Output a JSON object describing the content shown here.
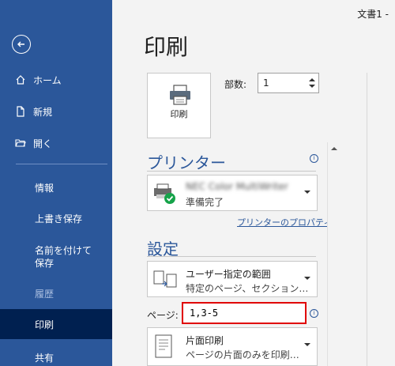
{
  "window": {
    "doc_title": "文書1  -"
  },
  "sidebar": {
    "items": [
      {
        "label": "ホーム",
        "icon": "home-icon"
      },
      {
        "label": "新規",
        "icon": "new-document-icon"
      },
      {
        "label": "開く",
        "icon": "open-folder-icon"
      },
      {
        "label": "情報"
      },
      {
        "label": "上書き保存"
      },
      {
        "label": "名前を付けて保存"
      },
      {
        "label": "履歴"
      },
      {
        "label": "印刷"
      },
      {
        "label": "共有"
      }
    ]
  },
  "main": {
    "title": "印刷",
    "print_button": "印刷",
    "copies_label": "部数:",
    "copies_value": "1",
    "printer_heading": "プリンター",
    "printer_name": "NEC Color MultiWriter",
    "printer_status": "準備完了",
    "printer_properties": "プリンターのプロパティ",
    "settings_heading": "設定",
    "range_title": "ユーザー指定の範囲",
    "range_sub": "特定のページ、セクション…",
    "pages_label": "ページ:",
    "pages_value": "1,3-5",
    "sides_title": "片面印刷",
    "sides_sub": "ページの片面のみを印刷…"
  },
  "colors": {
    "sidebar": "#2b579a",
    "selected": "#002050",
    "highlight_border": "#e00000"
  }
}
